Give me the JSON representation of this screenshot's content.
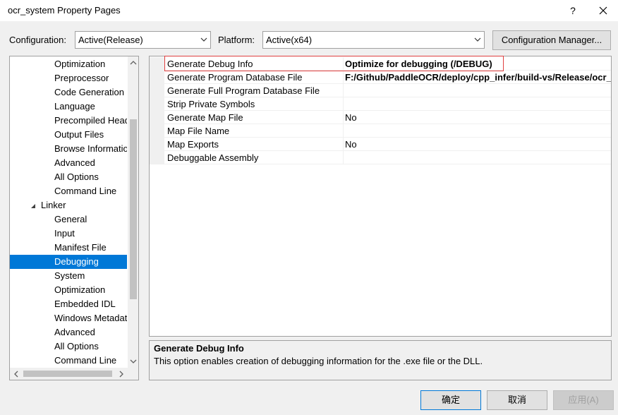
{
  "window": {
    "title": "ocr_system Property Pages",
    "help_label": "?"
  },
  "config": {
    "configuration_label": "Configuration:",
    "configuration_value": "Active(Release)",
    "platform_label": "Platform:",
    "platform_value": "Active(x64)",
    "manager_button": "Configuration Manager..."
  },
  "tree": {
    "items": [
      {
        "label": "Optimization"
      },
      {
        "label": "Preprocessor"
      },
      {
        "label": "Code Generation"
      },
      {
        "label": "Language"
      },
      {
        "label": "Precompiled Headers"
      },
      {
        "label": "Output Files"
      },
      {
        "label": "Browse Information"
      },
      {
        "label": "Advanced"
      },
      {
        "label": "All Options"
      },
      {
        "label": "Command Line"
      },
      {
        "label": "Linker"
      },
      {
        "label": "General"
      },
      {
        "label": "Input"
      },
      {
        "label": "Manifest File"
      },
      {
        "label": "Debugging"
      },
      {
        "label": "System"
      },
      {
        "label": "Optimization"
      },
      {
        "label": "Embedded IDL"
      },
      {
        "label": "Windows Metadata"
      },
      {
        "label": "Advanced"
      },
      {
        "label": "All Options"
      },
      {
        "label": "Command Line"
      }
    ],
    "selected_label": "Debugging"
  },
  "grid": {
    "rows": [
      {
        "name": "Generate Debug Info",
        "value": "Optimize for debugging (/DEBUG)"
      },
      {
        "name": "Generate Program Database File",
        "value": "F:/Github/PaddleOCR/deploy/cpp_infer/build-vs/Release/ocr_system.pdb"
      },
      {
        "name": "Generate Full Program Database File",
        "value": ""
      },
      {
        "name": "Strip Private Symbols",
        "value": ""
      },
      {
        "name": "Generate Map File",
        "value": "No"
      },
      {
        "name": "Map File Name",
        "value": ""
      },
      {
        "name": "Map Exports",
        "value": "No"
      },
      {
        "name": "Debuggable Assembly",
        "value": ""
      }
    ]
  },
  "description": {
    "title": "Generate Debug Info",
    "text": "This option enables creation of debugging information for the .exe file or the DLL."
  },
  "buttons": {
    "ok": "确定",
    "cancel": "取消",
    "apply": "应用(A)"
  }
}
